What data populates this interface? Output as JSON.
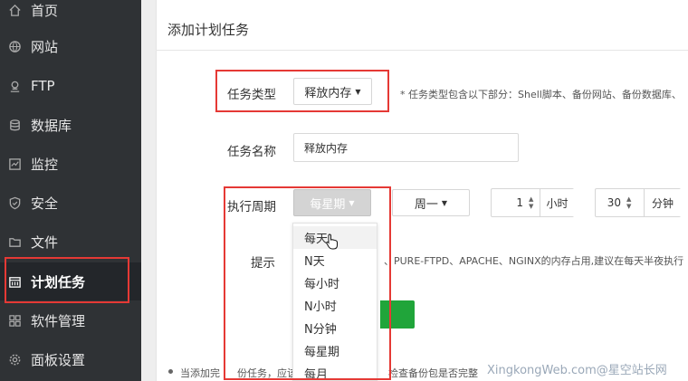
{
  "sidebar": {
    "items": [
      {
        "label": "首页",
        "icon": "home-icon"
      },
      {
        "label": "网站",
        "icon": "globe-icon"
      },
      {
        "label": "FTP",
        "icon": "ftp-icon"
      },
      {
        "label": "数据库",
        "icon": "database-icon"
      },
      {
        "label": "监控",
        "icon": "monitor-icon"
      },
      {
        "label": "安全",
        "icon": "shield-icon"
      },
      {
        "label": "文件",
        "icon": "folder-icon"
      },
      {
        "label": "计划任务",
        "icon": "calendar-icon",
        "active": true
      },
      {
        "label": "软件管理",
        "icon": "apps-icon"
      },
      {
        "label": "面板设置",
        "icon": "gear-icon"
      }
    ]
  },
  "panel": {
    "title": "添加计划任务",
    "task_type": {
      "label": "任务类型",
      "selected": "释放内存",
      "hint": "* 任务类型包含以下部分：Shell脚本、备份网站、备份数据库、"
    },
    "task_name": {
      "label": "任务名称",
      "value": "释放内存"
    },
    "cycle": {
      "label": "执行周期",
      "selected": "每星期",
      "weekday": "周一",
      "hour_value": "1",
      "hour_unit": "小时",
      "minute_value": "30",
      "minute_unit": "分钟",
      "options": [
        "每天",
        "N天",
        "每小时",
        "N小时",
        "N分钟",
        "每星期",
        "每月"
      ]
    },
    "tip": {
      "label": "提示",
      "text": "、PURE-FTPD、APACHE、NGINX的内存占用,建议在每天半夜执行"
    },
    "footer_note_left": "当添加完",
    "footer_note_mid": "份任务，应该",
    "footer_note_right": "检查备份包是否完整"
  },
  "watermark": "XingkongWeb.com@星空站长网",
  "colors": {
    "sidebar_bg": "#2f3235",
    "accent_green": "#20a53a",
    "highlight_red": "#e53935"
  }
}
